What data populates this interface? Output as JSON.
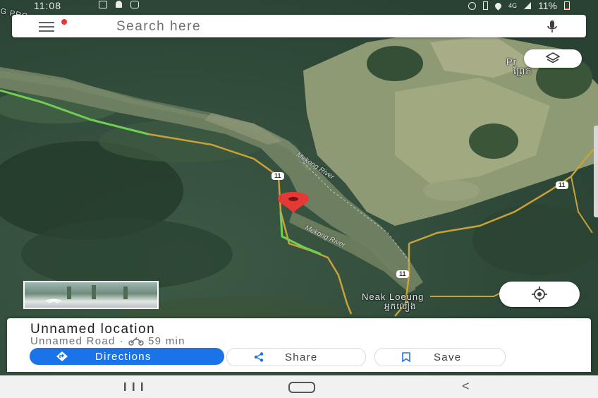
{
  "status_bar": {
    "time": "11:08",
    "signal_text": "4G",
    "battery": "11%"
  },
  "search": {
    "placeholder": "Search here",
    "menu_icon": "hamburger-menu-icon",
    "mic_icon": "microphone-icon"
  },
  "map": {
    "labels": {
      "prek_top": "Pr",
      "prek_top_right": "Pr",
      "khmer_top": "ព្រែក",
      "neak_loeung": "Neak Loeung",
      "neak_loeung_khmer": "អ្នកលឿង",
      "top_left_fragment": "G PRO",
      "river1": "Mekong River",
      "river2": "Mekong River"
    },
    "road_shields": [
      "11",
      "11",
      "11"
    ],
    "pin_color": "#e53935"
  },
  "controls": {
    "layers_icon": "layers-icon",
    "my_location_icon": "my-location-icon",
    "street_view_icon": "street-view-arrow-icon"
  },
  "place_card": {
    "title": "Unnamed location",
    "road": "Unnamed Road",
    "separator": "·",
    "travel_mode_icon": "motorcycle-icon",
    "duration": "59 min",
    "buttons": {
      "directions": "Directions",
      "share": "Share",
      "save": "Save"
    },
    "accent": "#1a73e8"
  },
  "nav_bar": {
    "recent_icon": "recent-apps-icon",
    "home_icon": "home-icon",
    "back_label": "<"
  }
}
